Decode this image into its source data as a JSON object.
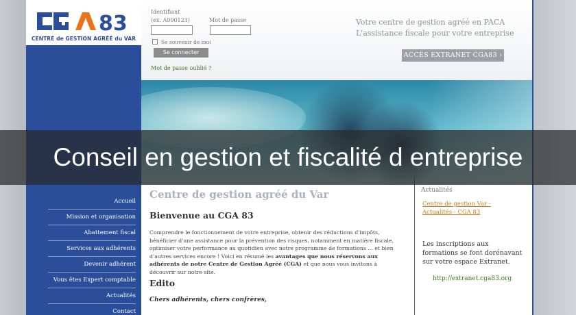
{
  "logo": {
    "letters": [
      "C",
      "G",
      "A",
      "8",
      "3"
    ],
    "caption": "CENTRE de GESTION AGRÉÉ du VAR"
  },
  "login": {
    "identifiant_label": "Identifiant",
    "identifiant_hint": "(ex. A000123)",
    "password_label": "Mot de passe",
    "remember_label": "Se souvenir de moi",
    "submit_label": "Se connecter",
    "forgot_label": "Mot de passe oublié ?"
  },
  "header": {
    "tagline_1": "Votre centre de gestion agréé en PACA",
    "tagline_2": "L'assistance fiscale pour votre entreprise",
    "extranet_button": "ACCÈS EXTRANET CGA83 ›"
  },
  "overlay": {
    "title": "Conseil en gestion et fiscalité d entreprise"
  },
  "nav": {
    "items": [
      "Accueil",
      "Mission et organisation",
      "Abattement fiscal",
      "Services aux adhérents",
      "Devenir adhérent",
      "Vous êtes Expert comptable",
      "Actualités",
      "Contact"
    ]
  },
  "content": {
    "page_title": "Centre de gestion agréé du Var",
    "welcome": "Bienvenue au CGA 83",
    "intro_1": "Comprendre le fonctionnement de votre entreprise, obtenir des réductions d'impôts, bénéficier d'une assistance pour la prévention des risques, notamment en matière fiscale, optimiser votre performance au quotidien avec notre programme de formations ... et bien d'autres services encore ! Voici en résumé les ",
    "intro_bold": "avantages que nous réservons aux adhérents de notre Centre de Gestion Agréé (CGA)",
    "intro_2": " et que nous vous invitons à découvrir sur notre site.",
    "edito_title": "Edito",
    "greeting": "Chers adhérents, chers confrères,"
  },
  "sidebar": {
    "heading": "Actualités",
    "news_link": "Centre de gestion Var - Actualités - CGA 83",
    "info_text": "Les inscriptions aux formations se font dorénavant sur votre espace Extranet.",
    "extranet_url": "http://extranet.cga83.org"
  },
  "colors": {
    "brand_blue": "#2a4e9a",
    "logo_orange": "#e8751a",
    "link_orange": "#d07a17",
    "link_green": "#3c7a24"
  }
}
